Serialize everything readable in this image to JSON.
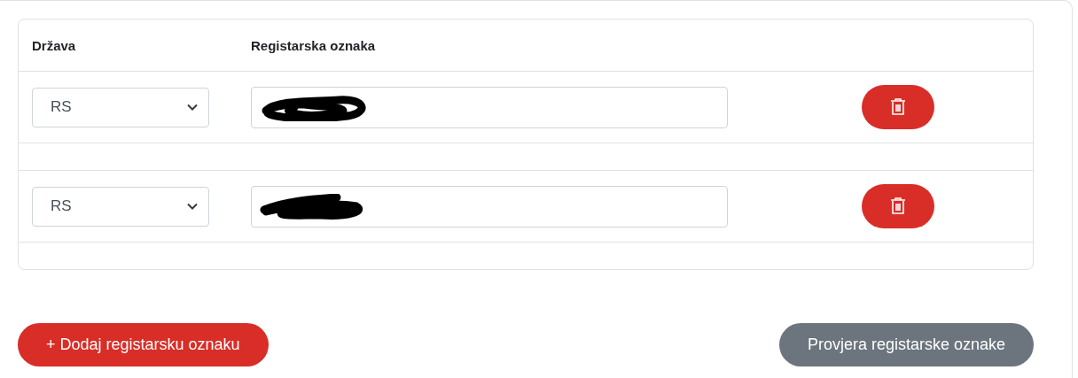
{
  "table": {
    "columns": [
      "Država",
      "Registarska oznaka"
    ],
    "rows": [
      {
        "country": "RS",
        "plate_redacted": true
      },
      {
        "country": "RS",
        "plate_redacted": true
      }
    ]
  },
  "buttons": [
    {
      "kind": "primary",
      "label": "+ Dodaj registarsku oznaku"
    },
    {
      "kind": "secondary",
      "label": "Provjera registarske oznake"
    }
  ]
}
